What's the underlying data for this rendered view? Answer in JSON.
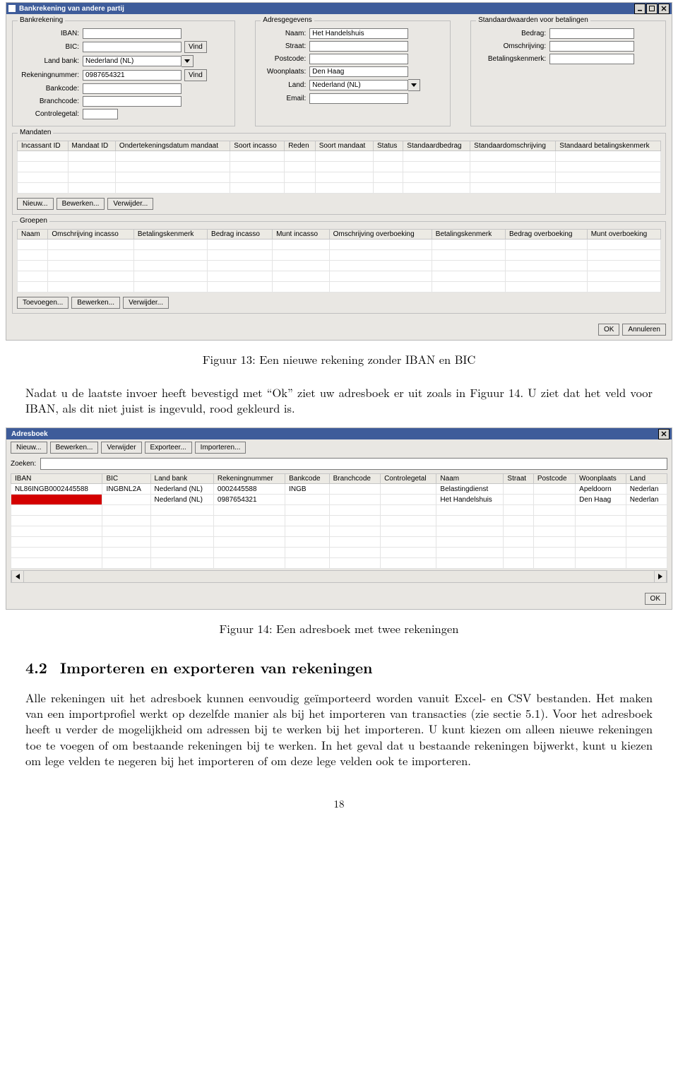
{
  "shot1": {
    "title": "Bankrekening van andere partij",
    "groups": {
      "bank": {
        "legend": "Bankrekening",
        "iban_lbl": "IBAN:",
        "bic_lbl": "BIC:",
        "land_lbl": "Land bank:",
        "land_val": "Nederland (NL)",
        "reknr_lbl": "Rekeningnummer:",
        "reknr_val": "0987654321",
        "bankcode_lbl": "Bankcode:",
        "branch_lbl": "Branchcode:",
        "ctrl_lbl": "Controlegetal:",
        "vind": "Vind"
      },
      "adres": {
        "legend": "Adresgegevens",
        "naam_lbl": "Naam:",
        "naam_val": "Het Handelshuis",
        "straat_lbl": "Straat:",
        "postcode_lbl": "Postcode:",
        "woonplaats_lbl": "Woonplaats:",
        "woonplaats_val": "Den Haag",
        "land_lbl": "Land:",
        "land_val": "Nederland (NL)",
        "email_lbl": "Email:"
      },
      "std": {
        "legend": "Standaardwaarden voor betalingen",
        "bedrag_lbl": "Bedrag:",
        "omschr_lbl": "Omschrijving:",
        "kenmerk_lbl": "Betalingskenmerk:"
      },
      "mandaten": {
        "legend": "Mandaten",
        "headers": [
          "Incassant ID",
          "Mandaat ID",
          "Ondertekeningsdatum mandaat",
          "Soort incasso",
          "Reden",
          "Soort mandaat",
          "Status",
          "Standaardbedrag",
          "Standaardomschrijving",
          "Standaard betalingskenmerk"
        ],
        "btns": {
          "nieuw": "Nieuw...",
          "bewerken": "Bewerken...",
          "verwijder": "Verwijder..."
        }
      },
      "groepen": {
        "legend": "Groepen",
        "headers": [
          "Naam",
          "Omschrijving incasso",
          "Betalingskenmerk",
          "Bedrag incasso",
          "Munt incasso",
          "Omschrijving overboeking",
          "Betalingskenmerk",
          "Bedrag overboeking",
          "Munt overboeking"
        ],
        "btns": {
          "toevoegen": "Toevoegen...",
          "bewerken": "Bewerken...",
          "verwijder": "Verwijder..."
        }
      }
    },
    "footer": {
      "ok": "OK",
      "ann": "Annuleren"
    }
  },
  "caption1": "Figuur 13: Een nieuwe rekening zonder IBAN en BIC",
  "para1": "Nadat u de laatste invoer heeft bevestigd met “Ok” ziet uw adresboek er uit zoals in Figuur 14. U ziet dat het veld voor IBAN, als dit niet juist is ingevuld, rood gekleurd is.",
  "shot2": {
    "title": "Adresboek",
    "toolbar": {
      "nieuw": "Nieuw...",
      "bewerken": "Bewerken...",
      "verwijder": "Verwijder",
      "export": "Exporteer...",
      "import": "Importeren..."
    },
    "zoeken_lbl": "Zoeken:",
    "headers": [
      "IBAN",
      "BIC",
      "Land bank",
      "Rekeningnummer",
      "Bankcode",
      "Branchcode",
      "Controlegetal",
      "Naam",
      "Straat",
      "Postcode",
      "Woonplaats",
      "Land"
    ],
    "rows": [
      {
        "iban": "NL86INGB0002445588",
        "bic": "INGBNL2A",
        "land": "Nederland (NL)",
        "reknr": "0002445588",
        "bankcode": "INGB",
        "branch": "",
        "ctrl": "",
        "naam": "Belastingdienst",
        "straat": "",
        "postcode": "",
        "woonplaats": "Apeldoorn",
        "land2": "Nederlan"
      },
      {
        "iban": "",
        "bic": "",
        "land": "Nederland (NL)",
        "reknr": "0987654321",
        "bankcode": "",
        "branch": "",
        "ctrl": "",
        "naam": "Het Handelshuis",
        "straat": "",
        "postcode": "",
        "woonplaats": "Den Haag",
        "land2": "Nederlan"
      }
    ],
    "ok": "OK"
  },
  "caption2": "Figuur 14: Een adresboek met twee rekeningen",
  "section": {
    "num": "4.2",
    "title": "Importeren en exporteren van rekeningen"
  },
  "para2": "Alle rekeningen uit het adresboek kunnen eenvoudig geïmporteerd worden vanuit Excel- en CSV bestanden. Het maken van een importprofiel werkt op dezelfde manier als bij het importeren van transacties (zie sectie 5.1). Voor het adresboek heeft u verder de mogelijkheid om adressen bij te werken bij het importeren. U kunt kiezen om alleen nieuwe rekeningen toe te voegen of om bestaande rekeningen bij te werken. In het geval dat u bestaande rekeningen bijwerkt, kunt u kiezen om lege velden te negeren bij het importeren of om deze lege velden ook te importeren.",
  "page_number": "18"
}
